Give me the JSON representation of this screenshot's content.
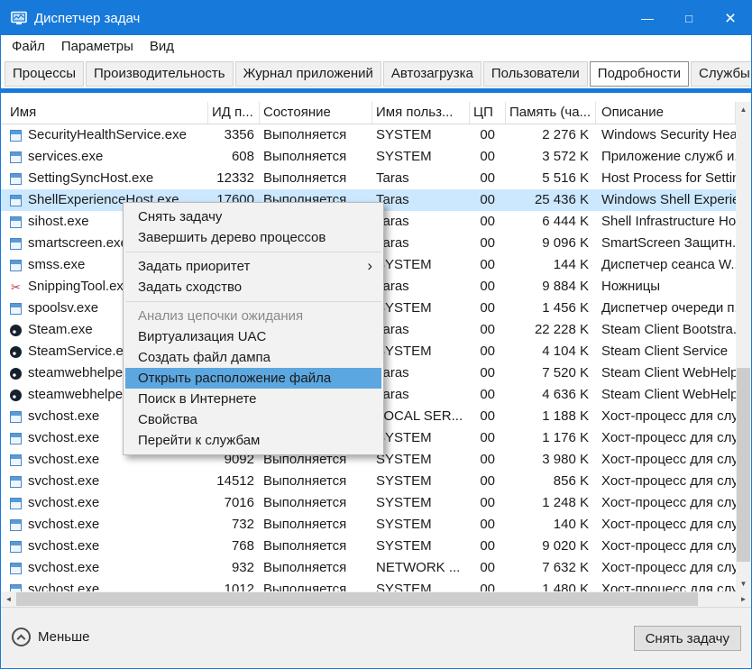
{
  "colors": {
    "titlebar": "#1779d9",
    "accent": "#1779d9",
    "selection-bg": "#cce8ff",
    "menu-highlight": "#5ca7e0",
    "disabled-text": "#8a8a8a"
  },
  "window": {
    "title": "Диспетчер задач",
    "controls": [
      {
        "name": "minimize",
        "glyph": "—"
      },
      {
        "name": "maximize",
        "glyph": "□"
      },
      {
        "name": "close",
        "glyph": "×"
      }
    ]
  },
  "menubar": {
    "items": [
      {
        "slug": "file",
        "label": "Файл"
      },
      {
        "slug": "options",
        "label": "Параметры"
      },
      {
        "slug": "view",
        "label": "Вид"
      }
    ]
  },
  "tabs": {
    "items": [
      {
        "slug": "processes",
        "label": "Процессы",
        "active": false
      },
      {
        "slug": "performance",
        "label": "Производительность",
        "active": false
      },
      {
        "slug": "app-history",
        "label": "Журнал приложений",
        "active": false
      },
      {
        "slug": "startup",
        "label": "Автозагрузка",
        "active": false
      },
      {
        "slug": "users",
        "label": "Пользователи",
        "active": false
      },
      {
        "slug": "details",
        "label": "Подробности",
        "active": true
      },
      {
        "slug": "services",
        "label": "Службы",
        "active": false
      }
    ]
  },
  "table": {
    "columns": [
      {
        "slug": "name",
        "label": "Имя"
      },
      {
        "slug": "pid",
        "label": "ИД п..."
      },
      {
        "slug": "status",
        "label": "Состояние"
      },
      {
        "slug": "user",
        "label": "Имя польз..."
      },
      {
        "slug": "cpu",
        "label": "ЦП"
      },
      {
        "slug": "memory",
        "label": "Память (ча..."
      },
      {
        "slug": "description",
        "label": "Описание"
      }
    ],
    "rows": [
      {
        "icon": "window",
        "name": "SecurityHealthService.exe",
        "pid": "3356",
        "status": "Выполняется",
        "user": "SYSTEM",
        "cpu": "00",
        "memory": "2 276 K",
        "description": "Windows Security Hea...",
        "selected": false
      },
      {
        "icon": "window",
        "name": "services.exe",
        "pid": "608",
        "status": "Выполняется",
        "user": "SYSTEM",
        "cpu": "00",
        "memory": "3 572 K",
        "description": "Приложение служб и...",
        "selected": false
      },
      {
        "icon": "window",
        "name": "SettingSyncHost.exe",
        "pid": "12332",
        "status": "Выполняется",
        "user": "Taras",
        "cpu": "00",
        "memory": "5 516 K",
        "description": "Host Process for Settin...",
        "selected": false
      },
      {
        "icon": "window",
        "name": "ShellExperienceHost.exe",
        "pid": "17600",
        "status": "Выполняется",
        "user": "Taras",
        "cpu": "00",
        "memory": "25 436 K",
        "description": "Windows Shell Experie...",
        "selected": true
      },
      {
        "icon": "window",
        "name": "sihost.exe",
        "pid": "",
        "status": "",
        "user": "Taras",
        "cpu": "00",
        "memory": "6 444 K",
        "description": "Shell Infrastructure Ho...",
        "selected": false
      },
      {
        "icon": "window",
        "name": "smartscreen.exe",
        "pid": "",
        "status": "",
        "user": "Taras",
        "cpu": "00",
        "memory": "9 096 K",
        "description": "SmartScreen Защитн...",
        "selected": false
      },
      {
        "icon": "window",
        "name": "smss.exe",
        "pid": "",
        "status": "",
        "user": "SYSTEM",
        "cpu": "00",
        "memory": "144 K",
        "description": "Диспетчер сеанса W...",
        "selected": false
      },
      {
        "icon": "scissors",
        "name": "SnippingTool.exe",
        "pid": "",
        "status": "",
        "user": "Taras",
        "cpu": "00",
        "memory": "9 884 K",
        "description": "Ножницы",
        "selected": false
      },
      {
        "icon": "window",
        "name": "spoolsv.exe",
        "pid": "",
        "status": "",
        "user": "SYSTEM",
        "cpu": "00",
        "memory": "1 456 K",
        "description": "Диспетчер очереди п...",
        "selected": false
      },
      {
        "icon": "steam",
        "name": "Steam.exe",
        "pid": "",
        "status": "",
        "user": "Taras",
        "cpu": "00",
        "memory": "22 228 K",
        "description": "Steam Client Bootstra...",
        "selected": false
      },
      {
        "icon": "steam",
        "name": "SteamService.exe",
        "pid": "",
        "status": "",
        "user": "SYSTEM",
        "cpu": "00",
        "memory": "4 104 K",
        "description": "Steam Client Service",
        "selected": false
      },
      {
        "icon": "steam",
        "name": "steamwebhelper.exe",
        "pid": "",
        "status": "",
        "user": "Taras",
        "cpu": "00",
        "memory": "7 520 K",
        "description": "Steam Client WebHelp...",
        "selected": false
      },
      {
        "icon": "steam",
        "name": "steamwebhelper.exe",
        "pid": "",
        "status": "",
        "user": "Taras",
        "cpu": "00",
        "memory": "4 636 K",
        "description": "Steam Client WebHelp...",
        "selected": false
      },
      {
        "icon": "window",
        "name": "svchost.exe",
        "pid": "",
        "status": "",
        "user": "LOCAL SER...",
        "cpu": "00",
        "memory": "1 188 K",
        "description": "Хост-процесс для слу...",
        "selected": false
      },
      {
        "icon": "window",
        "name": "svchost.exe",
        "pid": "",
        "status": "",
        "user": "SYSTEM",
        "cpu": "00",
        "memory": "1 176 K",
        "description": "Хост-процесс для слу...",
        "selected": false
      },
      {
        "icon": "window",
        "name": "svchost.exe",
        "pid": "9092",
        "status": "Выполняется",
        "user": "SYSTEM",
        "cpu": "00",
        "memory": "3 980 K",
        "description": "Хост-процесс для слу...",
        "selected": false
      },
      {
        "icon": "window",
        "name": "svchost.exe",
        "pid": "14512",
        "status": "Выполняется",
        "user": "SYSTEM",
        "cpu": "00",
        "memory": "856 K",
        "description": "Хост-процесс для слу...",
        "selected": false
      },
      {
        "icon": "window",
        "name": "svchost.exe",
        "pid": "7016",
        "status": "Выполняется",
        "user": "SYSTEM",
        "cpu": "00",
        "memory": "1 248 K",
        "description": "Хост-процесс для слу...",
        "selected": false
      },
      {
        "icon": "window",
        "name": "svchost.exe",
        "pid": "732",
        "status": "Выполняется",
        "user": "SYSTEM",
        "cpu": "00",
        "memory": "140 K",
        "description": "Хост-процесс для слу...",
        "selected": false
      },
      {
        "icon": "window",
        "name": "svchost.exe",
        "pid": "768",
        "status": "Выполняется",
        "user": "SYSTEM",
        "cpu": "00",
        "memory": "9 020 K",
        "description": "Хост-процесс для слу...",
        "selected": false
      },
      {
        "icon": "window",
        "name": "svchost.exe",
        "pid": "932",
        "status": "Выполняется",
        "user": "NETWORK ...",
        "cpu": "00",
        "memory": "7 632 K",
        "description": "Хост-процесс для слу...",
        "selected": false
      },
      {
        "icon": "window",
        "name": "svchost.exe",
        "pid": "1012",
        "status": "Выполняется",
        "user": "SYSTEM",
        "cpu": "00",
        "memory": "1 480 K",
        "description": "Хост-процесс для слу...",
        "selected": false
      }
    ]
  },
  "context_menu": {
    "items": [
      {
        "slug": "end-task",
        "label": "Снять задачу",
        "type": "normal"
      },
      {
        "slug": "end-process-tree",
        "label": "Завершить дерево процессов",
        "type": "normal"
      },
      {
        "type": "separator"
      },
      {
        "slug": "set-priority",
        "label": "Задать приоритет",
        "type": "submenu"
      },
      {
        "slug": "set-affinity",
        "label": "Задать сходство",
        "type": "normal"
      },
      {
        "type": "separator"
      },
      {
        "slug": "analyze-wait-chain",
        "label": "Анализ цепочки ожидания",
        "type": "disabled"
      },
      {
        "slug": "uac-virtualization",
        "label": "Виртуализация UAC",
        "type": "normal"
      },
      {
        "slug": "create-dump-file",
        "label": "Создать файл дампа",
        "type": "normal"
      },
      {
        "slug": "open-file-location",
        "label": "Открыть расположение файла",
        "type": "highlighted"
      },
      {
        "slug": "search-online",
        "label": "Поиск в Интернете",
        "type": "normal"
      },
      {
        "slug": "properties",
        "label": "Свойства",
        "type": "normal"
      },
      {
        "slug": "go-to-services",
        "label": "Перейти к службам",
        "type": "normal"
      }
    ]
  },
  "footer": {
    "less_label": "Меньше",
    "end_task_label": "Снять задачу"
  },
  "icons": {
    "scissors": "✂",
    "submenu_arrow": "›",
    "scroll_up": "▲",
    "scroll_down": "▼",
    "scroll_left": "◄",
    "scroll_right": "►"
  }
}
